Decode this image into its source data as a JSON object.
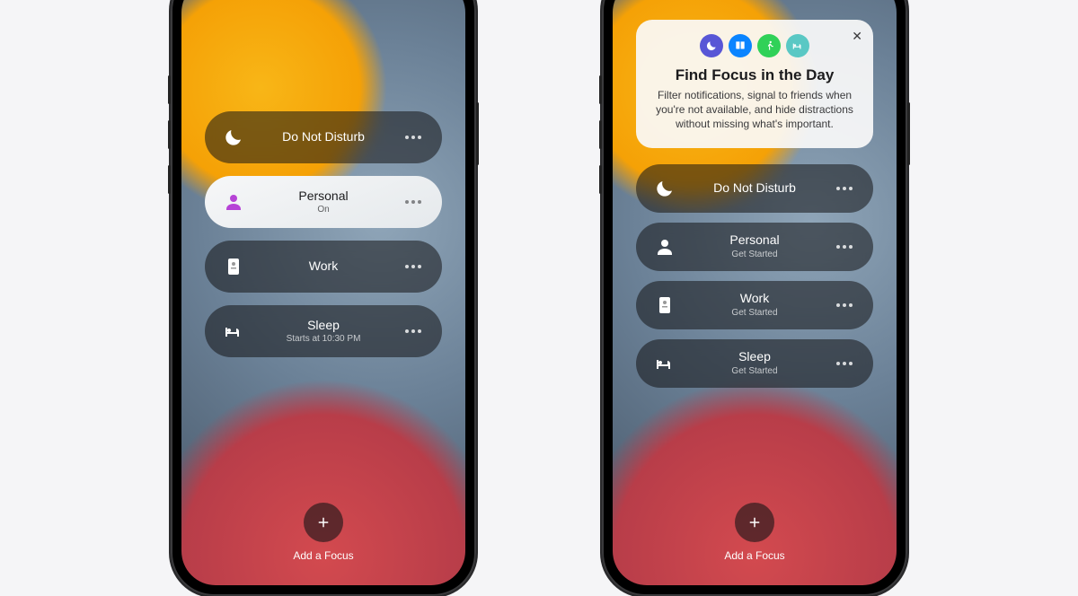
{
  "left": {
    "modes": [
      {
        "icon": "moon",
        "label": "Do Not Disturb",
        "sub": "",
        "active": false
      },
      {
        "icon": "person",
        "label": "Personal",
        "sub": "On",
        "active": true,
        "iconColor": "#b643d6"
      },
      {
        "icon": "badge",
        "label": "Work",
        "sub": "",
        "active": false
      },
      {
        "icon": "bed",
        "label": "Sleep",
        "sub": "Starts at 10:30 PM",
        "active": false
      }
    ],
    "addLabel": "Add a Focus"
  },
  "right": {
    "card": {
      "title": "Find Focus in the Day",
      "body": "Filter notifications, signal to friends when you're not available, and hide distractions without missing what's important.",
      "chips": [
        {
          "icon": "moon",
          "bg": "#5856d6"
        },
        {
          "icon": "book",
          "bg": "#0a84ff"
        },
        {
          "icon": "runner",
          "bg": "#30d158"
        },
        {
          "icon": "bed",
          "bg": "#5ac8c4"
        }
      ]
    },
    "modes": [
      {
        "icon": "moon",
        "label": "Do Not Disturb",
        "sub": ""
      },
      {
        "icon": "person",
        "label": "Personal",
        "sub": "Get Started"
      },
      {
        "icon": "badge",
        "label": "Work",
        "sub": "Get Started"
      },
      {
        "icon": "bed",
        "label": "Sleep",
        "sub": "Get Started"
      }
    ],
    "addLabel": "Add a Focus"
  }
}
